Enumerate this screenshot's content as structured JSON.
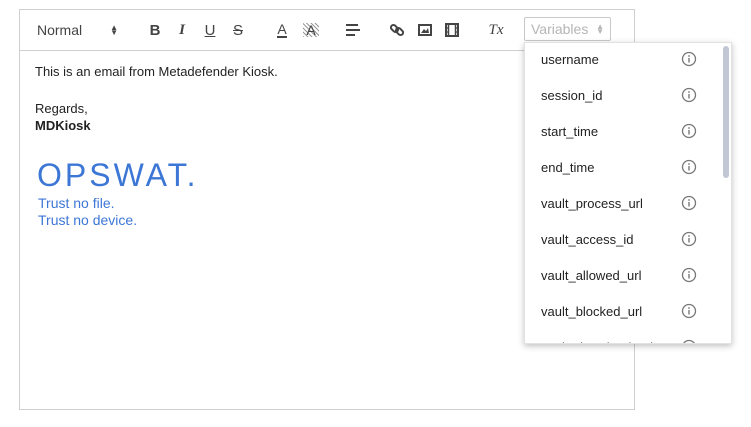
{
  "toolbar": {
    "style_select": {
      "value": "Normal",
      "icon": "up-down-arrows"
    },
    "buttons": [
      {
        "name": "bold-button",
        "label": "B"
      },
      {
        "name": "italic-button",
        "label": "I"
      },
      {
        "name": "underline-button",
        "label": "U"
      },
      {
        "name": "strikethrough-button",
        "label": "S"
      },
      {
        "name": "font-color-button",
        "label": "A"
      },
      {
        "name": "background-color-button",
        "label": "A"
      },
      {
        "name": "align-button",
        "icon": "align-left-icon"
      },
      {
        "name": "link-button",
        "icon": "link-icon"
      },
      {
        "name": "image-button",
        "icon": "image-icon"
      },
      {
        "name": "video-button",
        "icon": "video-icon"
      },
      {
        "name": "clear-format-button",
        "label": "Tx"
      }
    ],
    "variables_select": {
      "placeholder": "Variables"
    }
  },
  "content": {
    "line1": "This is an email from Metadefender Kiosk.",
    "regards": "Regards,",
    "signature": "MDKiosk",
    "logo_text": "OPSWAT.",
    "tagline1": "Trust no file.",
    "tagline2": "Trust no device."
  },
  "variables_dropdown": {
    "items": [
      {
        "label": "username"
      },
      {
        "label": "session_id"
      },
      {
        "label": "start_time"
      },
      {
        "label": "end_time"
      },
      {
        "label": "vault_process_url"
      },
      {
        "label": "vault_access_id"
      },
      {
        "label": "vault_allowed_url"
      },
      {
        "label": "vault_blocked_url"
      },
      {
        "label": "vault_download_url"
      }
    ]
  },
  "colors": {
    "brand_blue": "#3d77d6",
    "scrollbar_thumb": "#c1c7d4",
    "border": "#cfcfcf"
  }
}
